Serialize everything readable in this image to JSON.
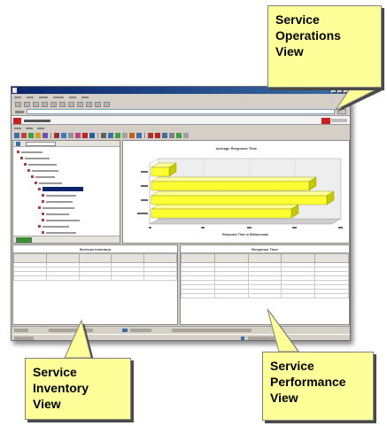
{
  "callouts": {
    "operations": "Service\nOperations\nView",
    "inventory": "Service\nInventory\nView",
    "performance": "Service\nPerformance\nView"
  },
  "screenshot": {
    "chart_title": "Average Response Time",
    "chart_xlabel": "Response Time in Milliseconds",
    "inventory_title": "Services Inventory",
    "performance_title": "Response Time",
    "colors": {
      "title_bar": "#0a246a",
      "brand_red": "#cc1f1f",
      "bar_fill": "#ffff33",
      "callout_fill": "#ffff99"
    }
  }
}
